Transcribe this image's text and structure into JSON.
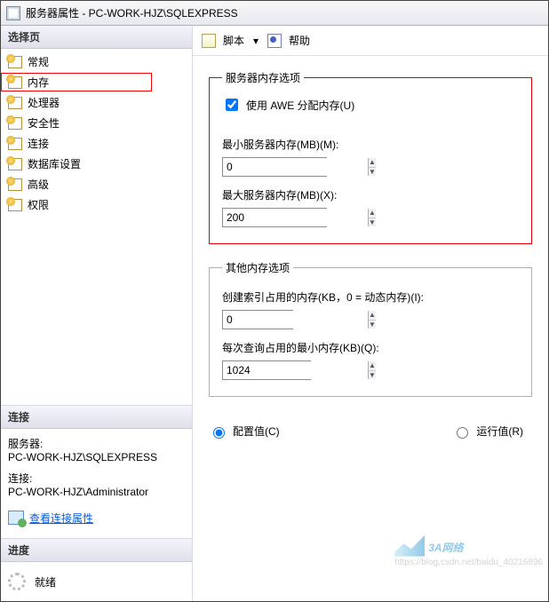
{
  "title": "服务器属性 - PC-WORK-HJZ\\SQLEXPRESS",
  "left": {
    "select_page": "选择页",
    "items": [
      "常规",
      "内存",
      "处理器",
      "安全性",
      "连接",
      "数据库设置",
      "高级",
      "权限"
    ],
    "connection_head": "连接",
    "server_label": "服务器:",
    "server_value": "PC-WORK-HJZ\\SQLEXPRESS",
    "conn_label": "连接:",
    "conn_value": "PC-WORK-HJZ\\Administrator",
    "view_props": "查看连接属性",
    "progress_head": "进度",
    "ready": "就绪"
  },
  "toolbar": {
    "script": "脚本",
    "help": "帮助"
  },
  "memory": {
    "legend": "服务器内存选项",
    "awe": "使用 AWE 分配内存(U)",
    "awe_checked": true,
    "min_label": "最小服务器内存(MB)(M):",
    "min_value": "0",
    "max_label": "最大服务器内存(MB)(X):",
    "max_value": "200"
  },
  "other": {
    "legend": "其他内存选项",
    "index_label": "创建索引占用的内存(KB，0 = 动态内存)(I):",
    "index_value": "0",
    "query_label": "每次查询占用的最小内存(KB)(Q):",
    "query_value": "1024"
  },
  "footer": {
    "configured": "配置值(C)",
    "running": "运行值(R)"
  },
  "watermark": {
    "brand": "3A网络",
    "url": "https://blog.csdn.net/baidu_40216896"
  }
}
